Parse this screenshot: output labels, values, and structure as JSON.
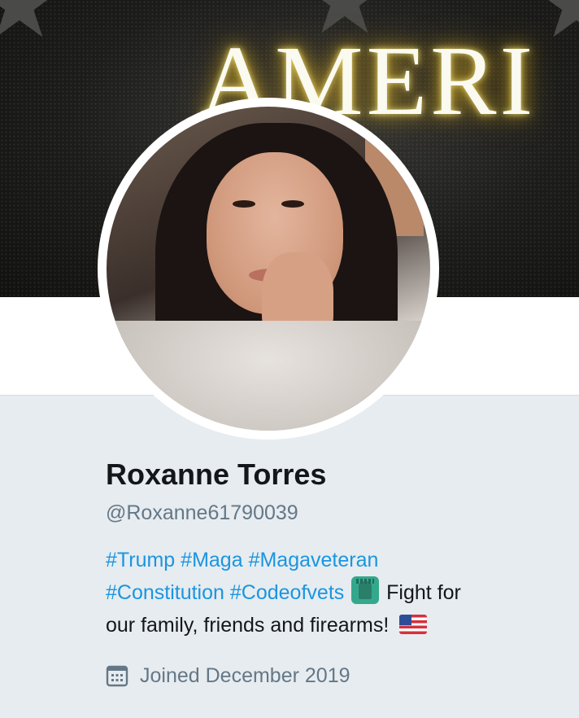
{
  "banner": {
    "word": "AMERI"
  },
  "profile": {
    "display_name": "Roxanne Torres",
    "handle": "@Roxanne61790039",
    "bio": {
      "hashtags_line1": [
        "#Trump",
        "#Maga",
        "#Magaveteran"
      ],
      "hashtags_line2": [
        "#Constitution",
        "#Codeofvets"
      ],
      "text_after_emoji": " Fight for",
      "text_line3": "our family, friends and firearms! "
    },
    "joined": "Joined December 2019",
    "emoji": {
      "liberty": "statue-of-liberty-emoji",
      "flag": "us-flag-emoji"
    }
  },
  "colors": {
    "link": "#1b95e0",
    "secondary_text": "#657786",
    "primary_text": "#14171a",
    "background": "#e6ecf0"
  }
}
